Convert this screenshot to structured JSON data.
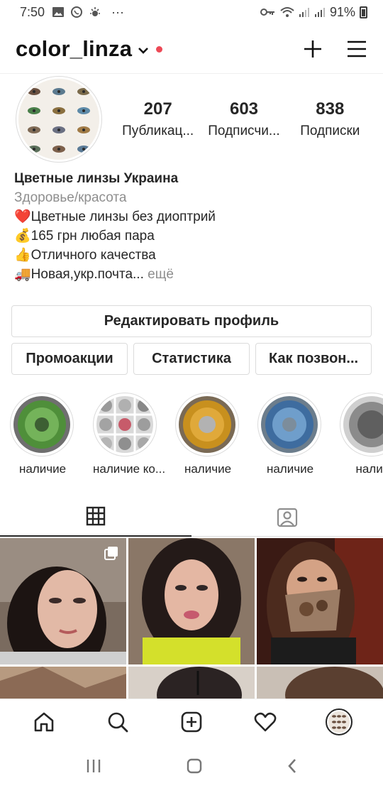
{
  "status_bar": {
    "time": "7:50",
    "dots": "···",
    "battery": "91%"
  },
  "header": {
    "username": "color_linza"
  },
  "profile": {
    "stats": [
      {
        "number": "207",
        "label": "Публикац..."
      },
      {
        "number": "603",
        "label": "Подписчи..."
      },
      {
        "number": "838",
        "label": "Подписки"
      }
    ],
    "name": "Цветные линзы Украина",
    "category": "Здоровье/красота",
    "bio_lines": [
      "❤️Цветные линзы без диоптрий",
      "💰165 грн любая пара",
      "👍Отличного качества"
    ],
    "bio_last": "🚚Новая,укр.почта...",
    "more": " ещё"
  },
  "buttons": {
    "edit": "Редактировать профиль",
    "promo": "Промоакции",
    "stats": "Статистика",
    "call": "Как позвон..."
  },
  "highlights": [
    {
      "label": "наличие",
      "color": "#4f8f3a"
    },
    {
      "label": "наличие ко...",
      "color": "#b7b7b7"
    },
    {
      "label": "наличие",
      "color": "#c8901e"
    },
    {
      "label": "наличие",
      "color": "#4d7fb5"
    },
    {
      "label": "налич",
      "color": "#8b8b8b"
    }
  ],
  "colors": {
    "accent_dot": "#ed4956",
    "border": "#dbdbdb",
    "text": "#262626",
    "muted": "#8e8e8e"
  }
}
